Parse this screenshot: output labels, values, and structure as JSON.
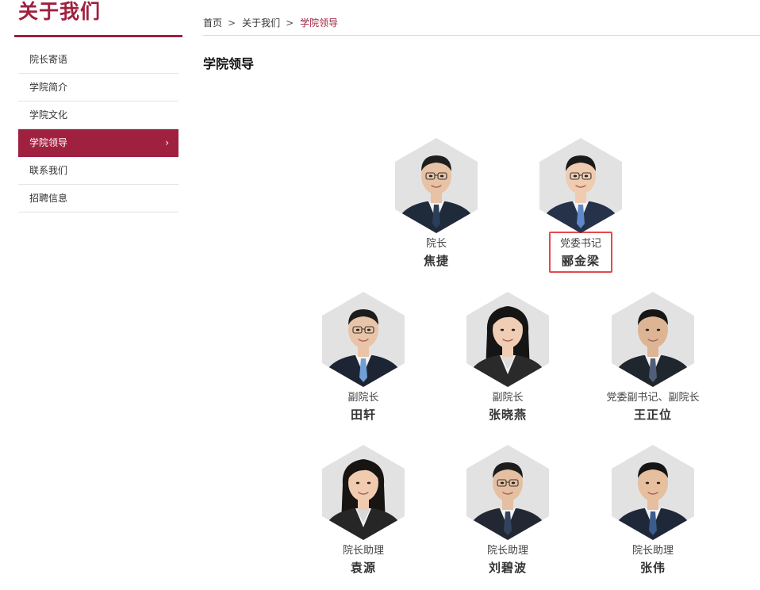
{
  "sidebar": {
    "title": "关于我们",
    "items": [
      {
        "label": "院长寄语"
      },
      {
        "label": "学院简介"
      },
      {
        "label": "学院文化"
      },
      {
        "label": "学院领导",
        "chevron": "›"
      },
      {
        "label": "联系我们"
      },
      {
        "label": "招聘信息"
      }
    ],
    "active_index": 3
  },
  "breadcrumb": {
    "items": [
      "首页",
      "关于我们",
      "学院领导"
    ],
    "separator": ">"
  },
  "page_title": "学院领导",
  "leaders": [
    {
      "role": "院长",
      "name": "焦捷",
      "highlighted": false,
      "photo": {
        "hair": "#1e1e1e",
        "suit": "#1f2a3a",
        "tie": "#2b3e5c",
        "skin": "#e8c2a4",
        "glasses": true
      }
    },
    {
      "role": "党委书记",
      "name": "郦金梁",
      "highlighted": true,
      "photo": {
        "hair": "#1a1a1a",
        "suit": "#25324a",
        "tie": "#5e88c8",
        "skin": "#efcbb0",
        "glasses": true
      }
    },
    {
      "role": "副院长",
      "name": "田轩",
      "highlighted": false,
      "photo": {
        "hair": "#1c1c1c",
        "suit": "#1d2433",
        "tie": "#6f9fd6",
        "skin": "#e9c4a8",
        "glasses": true
      }
    },
    {
      "role": "副院长",
      "name": "张晓燕",
      "highlighted": false,
      "photo": {
        "hair": "#151515",
        "suit": "#2a2a2a",
        "tie": "#dddddd",
        "skin": "#f0cdb5",
        "glasses": false,
        "long_hair": true
      }
    },
    {
      "role": "党委副书记、副院长",
      "name": "王正位",
      "highlighted": false,
      "photo": {
        "hair": "#161616",
        "suit": "#20262e",
        "tie": "#4f5f7a",
        "skin": "#ddb594",
        "glasses": false
      }
    },
    {
      "role": "院长助理",
      "name": "袁源",
      "highlighted": false,
      "photo": {
        "hair": "#171412",
        "suit": "#262626",
        "tie": "#d8d8d8",
        "skin": "#f0cbb0",
        "glasses": false,
        "long_hair": true
      }
    },
    {
      "role": "院长助理",
      "name": "刘碧波",
      "highlighted": false,
      "photo": {
        "hair": "#1d1d1d",
        "suit": "#222833",
        "tie": "#33435e",
        "skin": "#e4bfa2",
        "glasses": true
      }
    },
    {
      "role": "院长助理",
      "name": "张伟",
      "highlighted": false,
      "photo": {
        "hair": "#151515",
        "suit": "#1f2838",
        "tie": "#3c5b8e",
        "skin": "#e6bf9f",
        "glasses": false
      }
    }
  ]
}
